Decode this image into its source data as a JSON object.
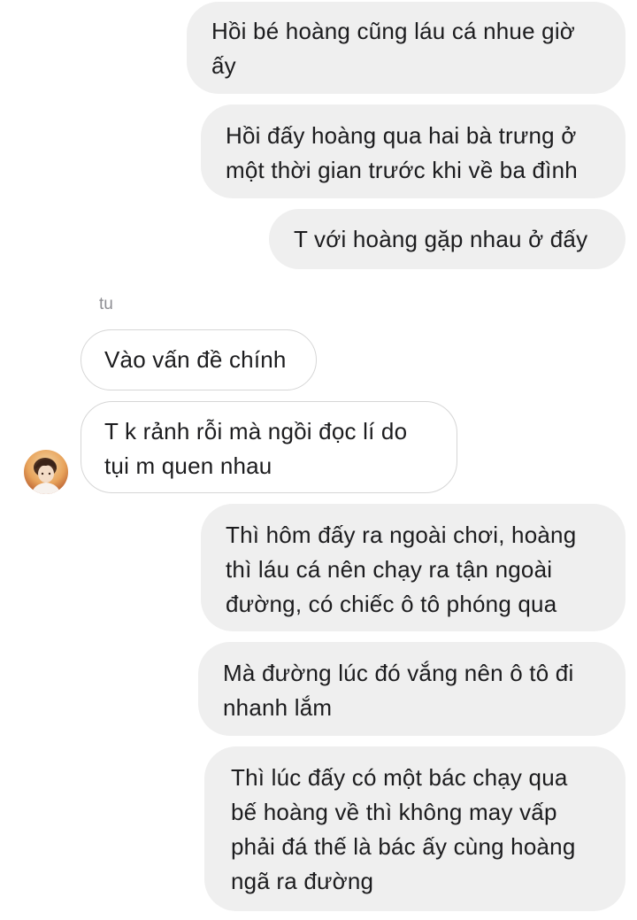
{
  "messages": {
    "m1": "Hồi bé hoàng cũng láu cá nhue giờ\nấy",
    "m2": "Hồi đấy hoàng qua hai bà trưng ở\nmột thời gian trước khi về ba đình",
    "m3": "T với hoàng gặp nhau ở đấy",
    "m4": "Vào vấn đề chính",
    "m5": "T k rảnh rỗi mà ngồi đọc lí do\ntụi m quen nhau",
    "m6": "Thì hôm đấy ra ngoài chơi, hoàng\nthì láu cá nên chạy ra tận ngoài\nđường, có chiếc ô tô phóng qua",
    "m7": "Mà đường lúc đó vắng nên ô tô đi\nnhanh lắm",
    "m8": "Thì lúc đấy có một bác chạy qua\nbế hoàng về thì không may vấp\nphải đá thế là bác ấy cùng hoàng\nngã ra đường"
  },
  "sender_name": "tu",
  "colors": {
    "outgoing_bubble": "#efefef",
    "incoming_border": "#d6d6d6",
    "text": "#1c1c1e",
    "meta_text": "#8e8e93"
  }
}
